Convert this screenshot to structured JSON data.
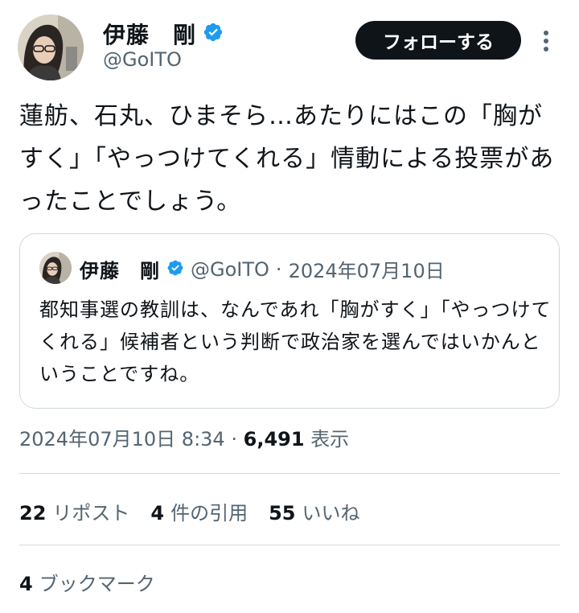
{
  "author": {
    "display_name": "伊藤　剛",
    "handle": "@GoITO",
    "verified": true,
    "accent_color": "#1d9bf0"
  },
  "actions": {
    "follow_label": "フォローする",
    "more_icon": "more-vertical-icon"
  },
  "tweet": {
    "text": "蓮舫、石丸、ひまそら…あたりにはこの「胸がすく」「やっつけてくれる」情動による投票があったことでしょう。"
  },
  "quoted": {
    "display_name": "伊藤　剛",
    "handle": "@GoITO",
    "separator": "·",
    "date": "2024年07月10日",
    "text": "都知事選の教訓は、なんであれ「胸がすく」「やっつけてくれる」候補者という判断で政治家を選んではいかんということですね。"
  },
  "meta": {
    "date": "2024年07月10日",
    "time": "8:34",
    "separator": "·",
    "views": "6,491",
    "views_label": "表示"
  },
  "stats": {
    "reposts": {
      "count": "22",
      "label": "リポスト"
    },
    "quotes": {
      "count": "4",
      "label": "件の引用"
    },
    "likes": {
      "count": "55",
      "label": "いいね"
    },
    "bookmarks": {
      "count": "4",
      "label": "ブックマーク"
    }
  }
}
